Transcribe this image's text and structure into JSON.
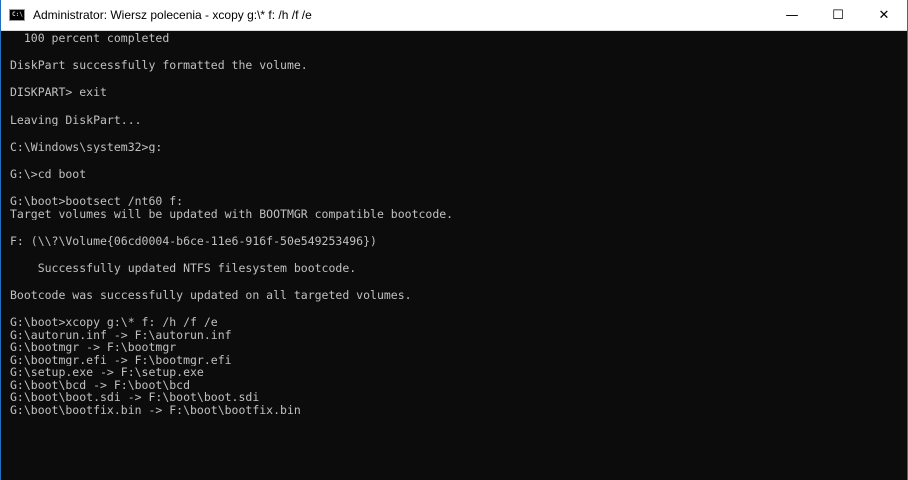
{
  "window": {
    "title": "Administrator: Wiersz polecenia - xcopy  g:\\* f: /h /f /e",
    "icon": "console-icon",
    "icon_text": "C:\\",
    "controls": {
      "minimize": "—",
      "maximize": "☐",
      "close": "✕"
    }
  },
  "console": {
    "lines": [
      "  100 percent completed",
      "",
      "DiskPart successfully formatted the volume.",
      "",
      "DISKPART> exit",
      "",
      "Leaving DiskPart...",
      "",
      "C:\\Windows\\system32>g:",
      "",
      "G:\\>cd boot",
      "",
      "G:\\boot>bootsect /nt60 f:",
      "Target volumes will be updated with BOOTMGR compatible bootcode.",
      "",
      "F: (\\\\?\\Volume{06cd0004-b6ce-11e6-916f-50e549253496})",
      "",
      "    Successfully updated NTFS filesystem bootcode.",
      "",
      "Bootcode was successfully updated on all targeted volumes.",
      "",
      "G:\\boot>xcopy g:\\* f: /h /f /e",
      "G:\\autorun.inf -> F:\\autorun.inf",
      "G:\\bootmgr -> F:\\bootmgr",
      "G:\\bootmgr.efi -> F:\\bootmgr.efi",
      "G:\\setup.exe -> F:\\setup.exe",
      "G:\\boot\\bcd -> F:\\boot\\bcd",
      "G:\\boot\\boot.sdi -> F:\\boot\\boot.sdi",
      "G:\\boot\\bootfix.bin -> F:\\boot\\bootfix.bin"
    ]
  },
  "colors": {
    "background": "#0c0c0c",
    "text": "#c0c0c0",
    "titlebar": "#ffffff",
    "border": "#1f6fbf"
  }
}
